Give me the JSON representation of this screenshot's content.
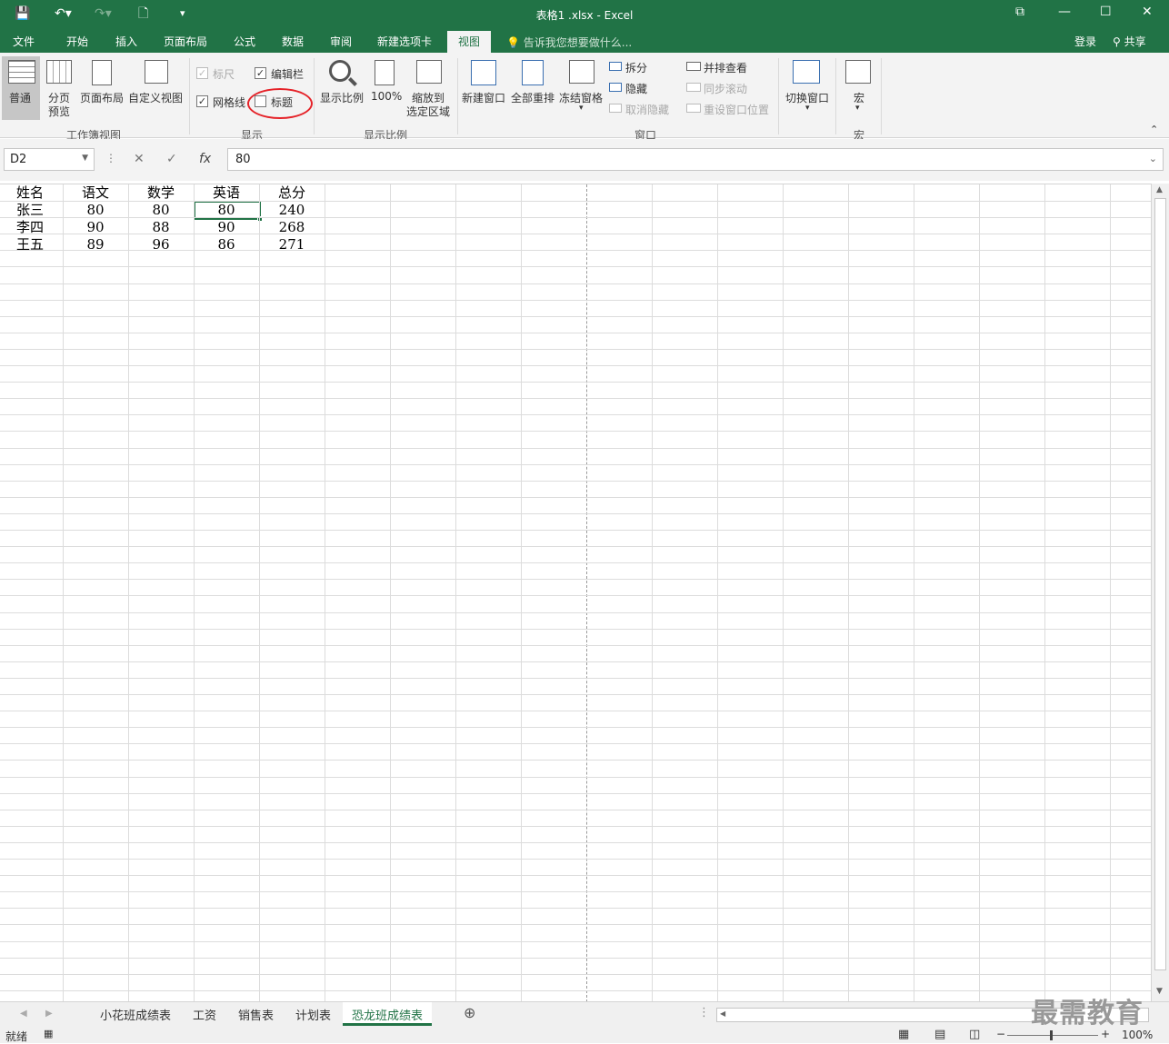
{
  "window": {
    "title": "表格1 .xlsx - Excel"
  },
  "menu_tabs": [
    "文件",
    "开始",
    "插入",
    "页面布局",
    "公式",
    "数据",
    "审阅",
    "新建选项卡",
    "视图"
  ],
  "tell_me": "告诉我您想要做什么...",
  "account": {
    "login": "登录",
    "share": "共享"
  },
  "ribbon": {
    "workbook_views": {
      "normal": "普通",
      "page_break_1": "分页",
      "page_break_2": "预览",
      "page_layout": "页面布局",
      "custom_views": "自定义视图",
      "group": "工作簿视图"
    },
    "show": {
      "ruler": "标尺",
      "formula_bar": "编辑栏",
      "gridlines": "网格线",
      "headings": "标题",
      "group": "显示",
      "ruler_checked": true,
      "formula_bar_checked": true,
      "gridlines_checked": true,
      "headings_checked": false
    },
    "zoom": {
      "zoom": "显示比例",
      "hundred": "100%",
      "zoom_sel_1": "缩放到",
      "zoom_sel_2": "选定区域",
      "group": "显示比例"
    },
    "window": {
      "new_window": "新建窗口",
      "arrange_all": "全部重排",
      "freeze_panes": "冻结窗格",
      "split": "拆分",
      "hide": "隐藏",
      "unhide": "取消隐藏",
      "side_by_side": "并排查看",
      "sync_scroll": "同步滚动",
      "reset_position": "重设窗口位置",
      "switch_windows": "切换窗口",
      "group": "窗口"
    },
    "macros": {
      "macros": "宏",
      "group": "宏"
    }
  },
  "formula_bar": {
    "name_box": "D2",
    "value": "80"
  },
  "sheet": {
    "headers": [
      "姓名",
      "语文",
      "数学",
      "英语",
      "总分"
    ],
    "rows": [
      [
        "张三",
        "80",
        "80",
        "80",
        "240"
      ],
      [
        "李四",
        "90",
        "88",
        "90",
        "268"
      ],
      [
        "王五",
        "89",
        "96",
        "86",
        "271"
      ]
    ]
  },
  "sheet_tabs": [
    "小花班成绩表",
    "工资",
    "销售表",
    "计划表",
    "恐龙班成绩表"
  ],
  "status": {
    "ready": "就绪",
    "zoom": "100%"
  },
  "watermark": "最需教育"
}
